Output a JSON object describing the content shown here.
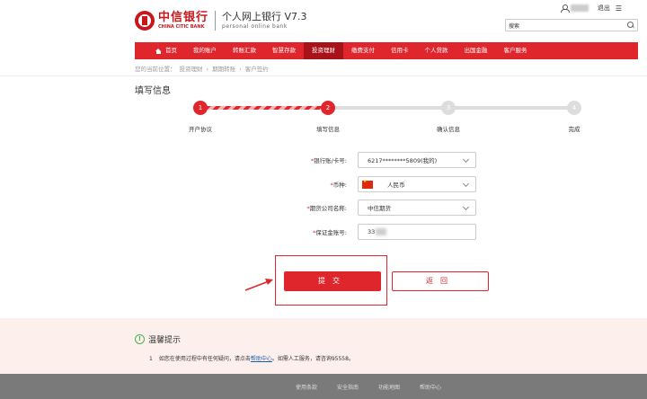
{
  "header": {
    "bank_name": "中信银行",
    "bank_name_en": "CHINA CITIC BANK",
    "system_title": "个人网上银行 V7.3",
    "system_subtitle": "personal online bank",
    "logout": "退出",
    "more": "☰",
    "search_placeholder": "搜索"
  },
  "nav": {
    "items": [
      "首页",
      "我的账户",
      "转账汇款",
      "智慧存款",
      "投资理财",
      "缴费支付",
      "信用卡",
      "个人贷款",
      "出国金融",
      "客户服务"
    ],
    "active_index": 4
  },
  "breadcrumb": {
    "label": "您的当前位置：",
    "path": [
      "投资理财",
      "期期转账",
      "客户签约"
    ],
    "separator": "›"
  },
  "page": {
    "title": "填写信息"
  },
  "steps": [
    {
      "num": "1",
      "label": "开户协议",
      "state": "done"
    },
    {
      "num": "2",
      "label": "填写信息",
      "state": "done"
    },
    {
      "num": "3",
      "label": "确认信息",
      "state": "todo"
    },
    {
      "num": "4",
      "label": "完成",
      "state": "todo"
    }
  ],
  "form": {
    "account_label": "银行账/卡号:",
    "account_value": "6217********5809(我的)",
    "currency_label": "币种:",
    "currency_value": "人民币",
    "company_label": "期货公司名称:",
    "company_value": "中信期货",
    "margin_label": "保证金账号:",
    "margin_value": "33",
    "required_mark": "*"
  },
  "buttons": {
    "submit": "提交",
    "back": "返回"
  },
  "tips": {
    "title": "温馨提示",
    "icon_text": "!",
    "number": "1",
    "text_before": "如您在使用过程中有任何疑问，请点击",
    "link": "帮助中心",
    "text_after": "。如需人工服务，请咨询95558。"
  },
  "footer": {
    "links": [
      "使用条款",
      "安全指南",
      "功能地图",
      "帮助中心"
    ]
  },
  "colors": {
    "brand_red": "#e0262d",
    "active_nav": "#a8131a",
    "tips_bg": "#fdf0ec",
    "footer_bg": "#7a7a7a"
  }
}
